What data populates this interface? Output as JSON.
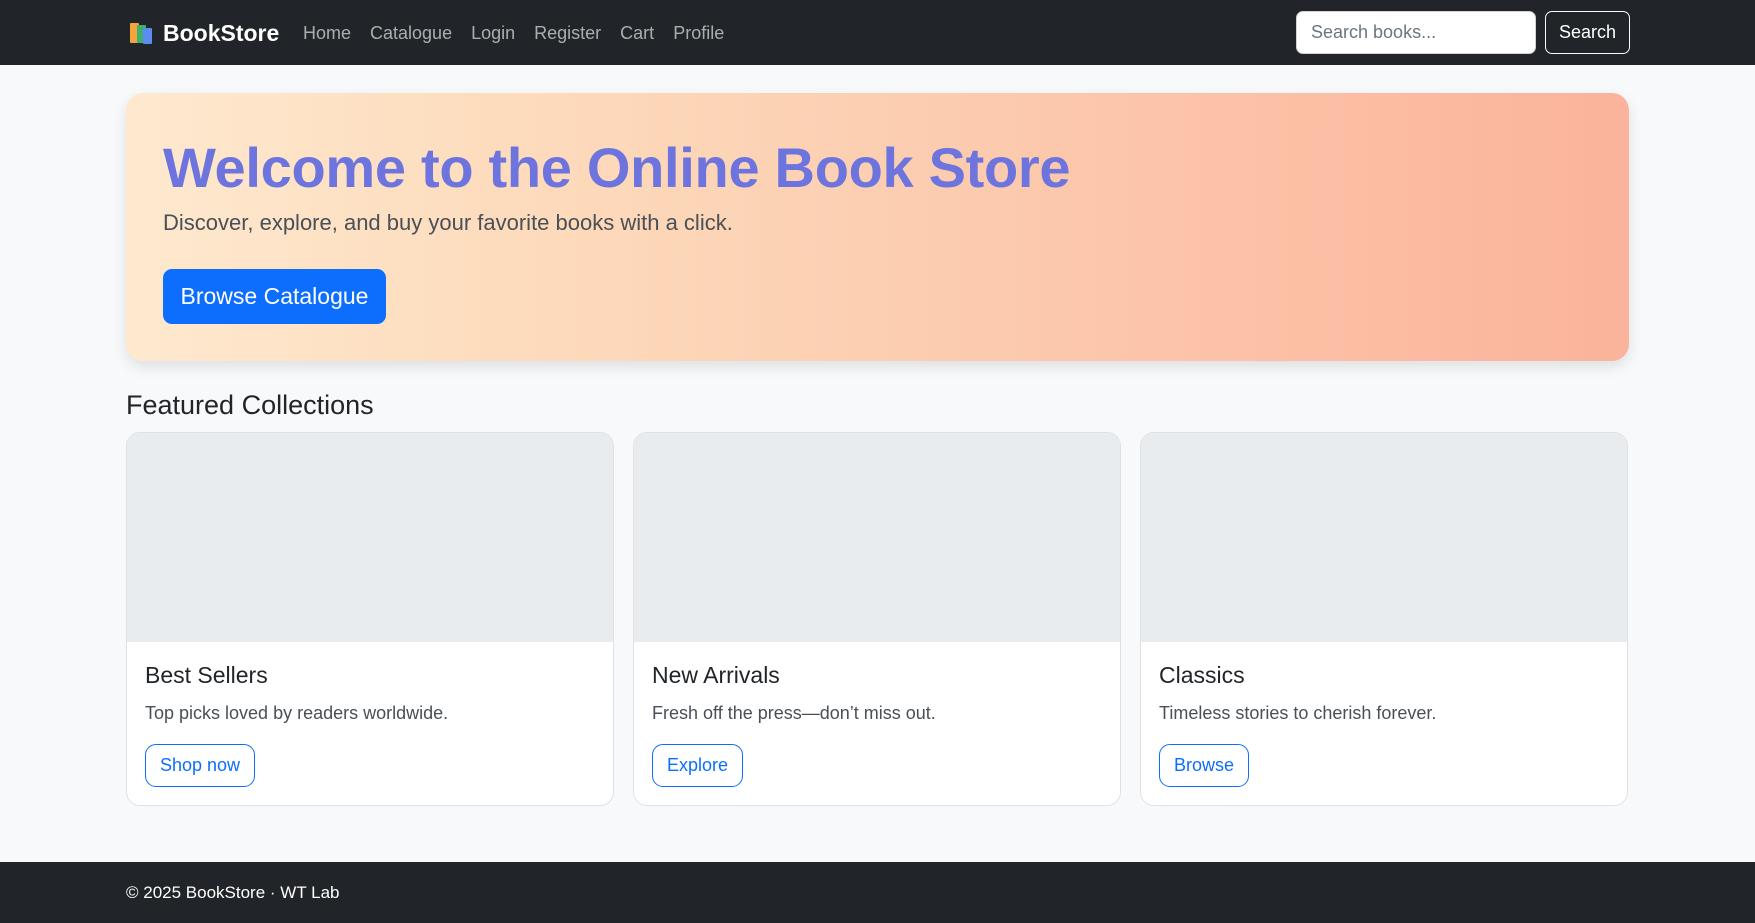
{
  "nav": {
    "brand": "BookStore",
    "brand_icon": "books-icon",
    "links": [
      "Home",
      "Catalogue",
      "Login",
      "Register",
      "Cart",
      "Profile"
    ],
    "search_placeholder": "Search books...",
    "search_button": "Search"
  },
  "hero": {
    "title": "Welcome to the Online Book Store",
    "subtitle": "Discover, explore, and buy your favorite books with a click.",
    "button": "Browse Catalogue"
  },
  "featured": {
    "title": "Featured Collections",
    "cards": [
      {
        "title": "Best Sellers",
        "text": "Top picks loved by readers worldwide.",
        "button": "Shop now"
      },
      {
        "title": "New Arrivals",
        "text": "Fresh off the press—don’t miss out.",
        "button": "Explore"
      },
      {
        "title": "Classics",
        "text": "Timeless stories to cherish forever.",
        "button": "Browse"
      }
    ]
  },
  "footer": {
    "text": "© 2025 BookStore · WT Lab"
  },
  "colors": {
    "navbar": "#212529",
    "accent": "#0d6efd",
    "hero_title": "#6d74dd"
  }
}
